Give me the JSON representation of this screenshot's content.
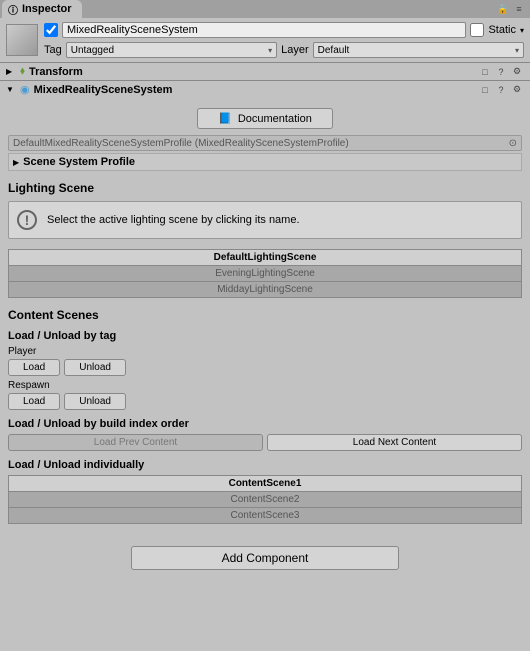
{
  "tab": {
    "title": "Inspector"
  },
  "header": {
    "name": "MixedRealitySceneSystem",
    "static_label": "Static",
    "tag_label": "Tag",
    "tag_value": "Untagged",
    "layer_label": "Layer",
    "layer_value": "Default",
    "active": true,
    "static": false
  },
  "transform": {
    "title": "Transform"
  },
  "component": {
    "title": "MixedRealitySceneSystem",
    "doc_button": "Documentation",
    "profile_field": "DefaultMixedRealitySceneSystemProfile (MixedRealitySceneSystemProfile)",
    "profile_subheader": "Scene System Profile",
    "lighting": {
      "title": "Lighting Scene",
      "info": "Select the active lighting scene by clicking its name.",
      "scenes": [
        "DefaultLightingScene",
        "EveningLightingScene",
        "MiddayLightingScene"
      ],
      "selected": 0
    },
    "content": {
      "title": "Content Scenes",
      "by_tag_label": "Load / Unload by tag",
      "tags": [
        "Player",
        "Respawn"
      ],
      "load_label": "Load",
      "unload_label": "Unload",
      "by_index_label": "Load / Unload by build index order",
      "prev_label": "Load Prev Content",
      "next_label": "Load Next Content",
      "individually_label": "Load / Unload individually",
      "scenes": [
        "ContentScene1",
        "ContentScene2",
        "ContentScene3"
      ],
      "selected": 0
    }
  },
  "add_component": "Add Component"
}
